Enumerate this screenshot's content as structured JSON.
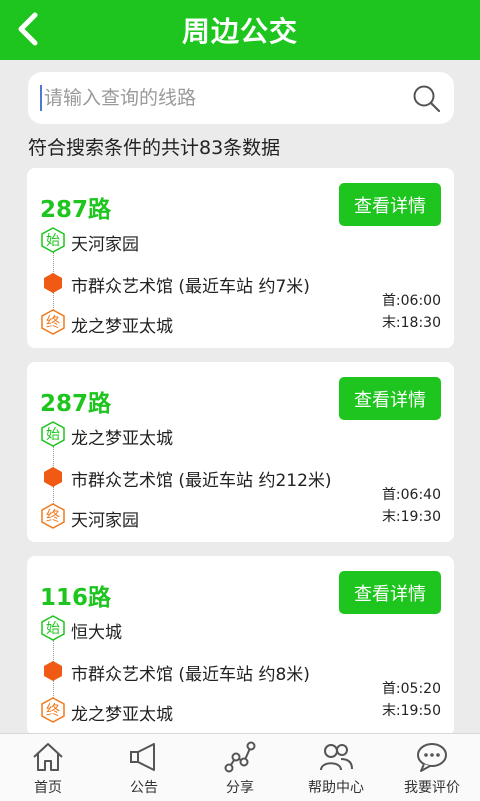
{
  "header": {
    "title": "周边公交"
  },
  "search": {
    "placeholder": "请输入查询的线路"
  },
  "result_count_text": "符合搜索条件的共计83条数据",
  "routes": [
    {
      "name": "287路",
      "detail_label": "查看详情",
      "start_tag": "始",
      "start_stop": "天河家园",
      "nearest_stop": "市群众艺术馆 (最近车站 约7米)",
      "end_tag": "终",
      "end_stop": "龙之梦亚太城",
      "first_time": "首:06:00",
      "last_time": "末:18:30"
    },
    {
      "name": "287路",
      "detail_label": "查看详情",
      "start_tag": "始",
      "start_stop": "龙之梦亚太城",
      "nearest_stop": "市群众艺术馆 (最近车站 约212米)",
      "end_tag": "终",
      "end_stop": "天河家园",
      "first_time": "首:06:40",
      "last_time": "末:19:30"
    },
    {
      "name": "116路",
      "detail_label": "查看详情",
      "start_tag": "始",
      "start_stop": "恒大城",
      "nearest_stop": "市群众艺术馆 (最近车站 约8米)",
      "end_tag": "终",
      "end_stop": "龙之梦亚太城",
      "first_time": "首:05:20",
      "last_time": "末:19:50"
    }
  ],
  "bottom_nav": [
    {
      "label": "首页",
      "icon": "home-icon"
    },
    {
      "label": "公告",
      "icon": "megaphone-icon"
    },
    {
      "label": "分享",
      "icon": "share-icon"
    },
    {
      "label": "帮助中心",
      "icon": "help-center-icon"
    },
    {
      "label": "我要评价",
      "icon": "comment-icon"
    }
  ],
  "colors": {
    "brand_green": "#1ec51e",
    "start_green": "#1ec51e",
    "end_orange": "#f07a1e",
    "stop_orange": "#f05a14",
    "background": "#ebebeb"
  }
}
